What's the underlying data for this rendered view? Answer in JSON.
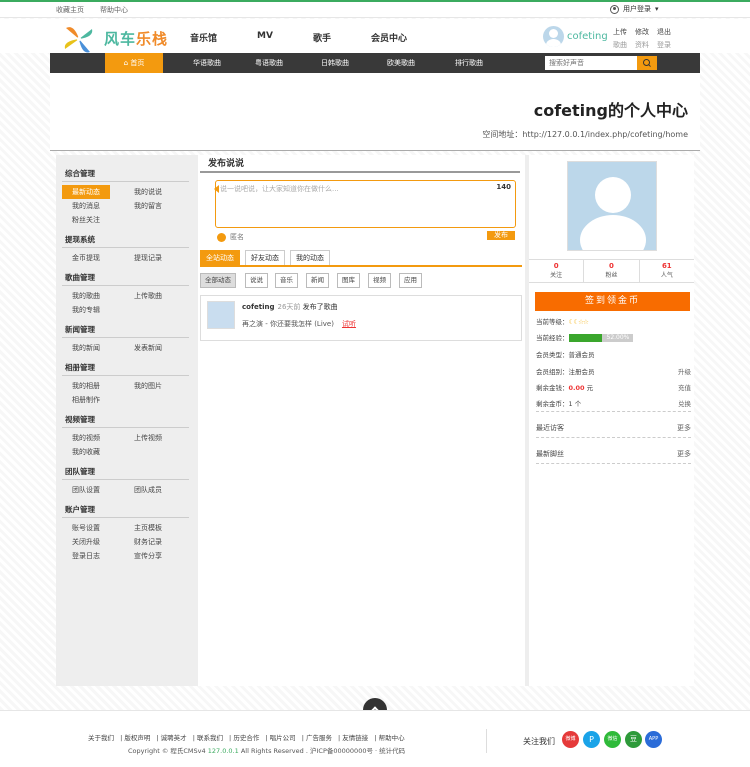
{
  "topbar": {
    "fav": "收藏主页",
    "help": "帮助中心",
    "login": "用户登录"
  },
  "header": {
    "logo_a": "风车",
    "logo_b": "乐栈",
    "nav": [
      "音乐馆",
      "MV",
      "歌手",
      "会员中心"
    ],
    "username": "cofeting",
    "links": [
      "上传",
      "修改",
      "退出",
      "歌曲",
      "资料",
      "登录"
    ]
  },
  "nav": {
    "items": [
      "首页",
      "华语歌曲",
      "粤语歌曲",
      "日韩歌曲",
      "欧美歌曲",
      "排行歌曲"
    ],
    "search_placeholder": "搜索好声音"
  },
  "banner": {
    "title": "cofeting的个人中心",
    "url_label": "空间地址：",
    "url": "http://127.0.0.1/index.php/cofeting/home"
  },
  "sidebar": {
    "sections": [
      "综合管理",
      "提现系统",
      "歌曲管理",
      "新闻管理",
      "相册管理",
      "视频管理",
      "团队管理",
      "账户管理"
    ],
    "links": [
      "最新动态",
      "我的说说",
      "我的消息",
      "我的留言",
      "粉丝关注",
      "金币提现",
      "提现记录",
      "我的歌曲",
      "上传歌曲",
      "我的专辑",
      "我的新闻",
      "发表新闻",
      "我的相册",
      "我的图片",
      "相册制作",
      "我的视频",
      "上传视频",
      "我的收藏",
      "团队设置",
      "团队成员",
      "账号设置",
      "主页模板",
      "关闭升级",
      "财务记录",
      "登录日志",
      "宣传分享"
    ]
  },
  "post_box": {
    "title": "发布说说",
    "placeholder": "说一说吧说，让大家知道你在做什么...",
    "count": "140",
    "anon": "匿名",
    "publish": "发布"
  },
  "tabs": [
    "全站动态",
    "好友动态",
    "我的动态"
  ],
  "filters": [
    "全部动态",
    "说说",
    "音乐",
    "新闻",
    "图库",
    "视频",
    "应用"
  ],
  "feed": [
    {
      "user": "cofeting",
      "time": "26天前",
      "action": "发布了歌曲",
      "text": "再之演 - 你还要我怎样 (Live)",
      "tag": "试听"
    }
  ],
  "profile": {
    "stats": [
      {
        "value": "0",
        "label": "关注"
      },
      {
        "value": "0",
        "label": "粉丝"
      },
      {
        "value": "61",
        "label": "人气"
      }
    ],
    "sign_button": "签到领金币",
    "level_label": "当前等级：",
    "exp_label": "当前经验：",
    "exp_percent": "52.00%",
    "exp_fraction": 0.52,
    "member_type": "会员类型：普通会员",
    "member_group": "会员组别：注册会员",
    "upgrade": "升级",
    "coins_label": "剩余金钱：",
    "coins_value": "0.00",
    "coins_unit": "元",
    "recharge": "充值",
    "gold_label": "剩余金币：",
    "gold_value": "1",
    "gold_unit": "个",
    "exchange": "兑换",
    "recent_visitors": "最近访客",
    "recent_traces": "最新脚丝",
    "more": "更多"
  },
  "footer": {
    "links": [
      "关于我们",
      "版权声明",
      "诚聘英才",
      "联系我们",
      "历史合作",
      "唱片公司",
      "广告服务",
      "友情链接",
      "帮助中心"
    ],
    "copyright": "Copyright © 程氏CMSv4",
    "version": "127.0.0.1",
    "rights": "All Rights Reserved .",
    "icp": "沪ICP备00000000号 · 统计代码",
    "follow": "关注我们",
    "social": [
      "微博",
      "P",
      "微信",
      "豆",
      "APP"
    ]
  },
  "colors": {
    "accent": "#f39a0f",
    "green": "#3bab5f",
    "nav_bg": "#393939"
  }
}
